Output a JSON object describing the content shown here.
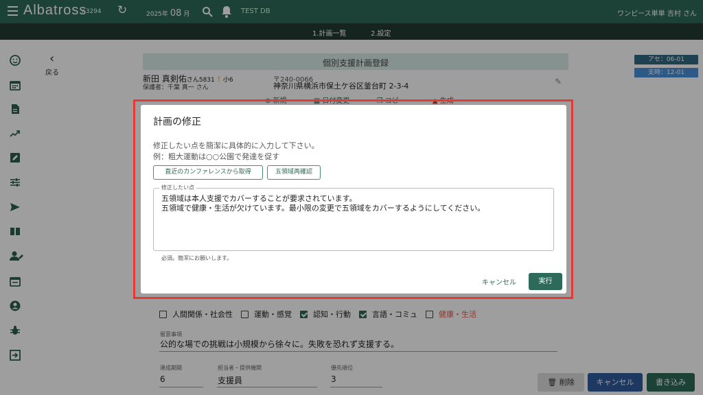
{
  "app": {
    "brand": "Albatross",
    "code": "r.3294",
    "date_year": "2025年",
    "date_month": "08",
    "date_suffix": "月",
    "db": "TEST DB",
    "user": "ワンピース単単 吉村 さん"
  },
  "steps": [
    "1.計画一覧",
    "2.設定"
  ],
  "back_label": "戻る",
  "page_header": "個別支援計画登録",
  "tags": [
    "アセ：06-01",
    "支時：12-01"
  ],
  "child": {
    "name": "新田 真剣佑",
    "honorific": "さん",
    "id": "5831",
    "grade": "小6",
    "guardian": "保護者：千葉 真一 さん",
    "zip": "〒240-0066",
    "address": "神奈川県横浜市保土ケ谷区釜台町 2-3-4"
  },
  "bg_actions": [
    "新規",
    "日付変更",
    "コピー",
    "生成"
  ],
  "checks": [
    {
      "label": "人間関係・社会性",
      "checked": false
    },
    {
      "label": "運動・感覚",
      "checked": false
    },
    {
      "label": "認知・行動",
      "checked": true
    },
    {
      "label": "言語・コミュ",
      "checked": true
    },
    {
      "label": "健康・生活",
      "checked": false
    }
  ],
  "notes": {
    "label": "留意事項",
    "value": "公的な場での挑戦は小規模から徐々に。失敗を恐れず支援する。"
  },
  "fields": {
    "period_label": "達成期間",
    "period_value": "6",
    "staff_label": "担当者・提供機関",
    "staff_value": "支援員",
    "priority_label": "優先順位",
    "priority_value": "3"
  },
  "bottom_buttons": {
    "delete": "削除",
    "cancel": "キャンセル",
    "save": "書き込み"
  },
  "dialog": {
    "title": "計画の修正",
    "instruction": "修正したい点を簡潔に具体的に入力して下さい。",
    "example": "例：粗大運動は○○公園で発達を促す",
    "chip1": "直近のカンファレンスから取得",
    "chip2": "五領域再確認",
    "textarea_label": "修正したい点",
    "textarea_lines": [
      "五領域は本人支援でカバーすることが要求されています。",
      "五領域で健康・生活が欠けています。最小限の変更で五領域をカバーするようにしてください。"
    ],
    "help": "必須。簡潔にお願いします。",
    "cancel": "キャンセル",
    "execute": "実行"
  },
  "colors": {
    "primary": "#2e6a59",
    "header_bg": "#d7ece7",
    "highlight": "#e53935"
  }
}
